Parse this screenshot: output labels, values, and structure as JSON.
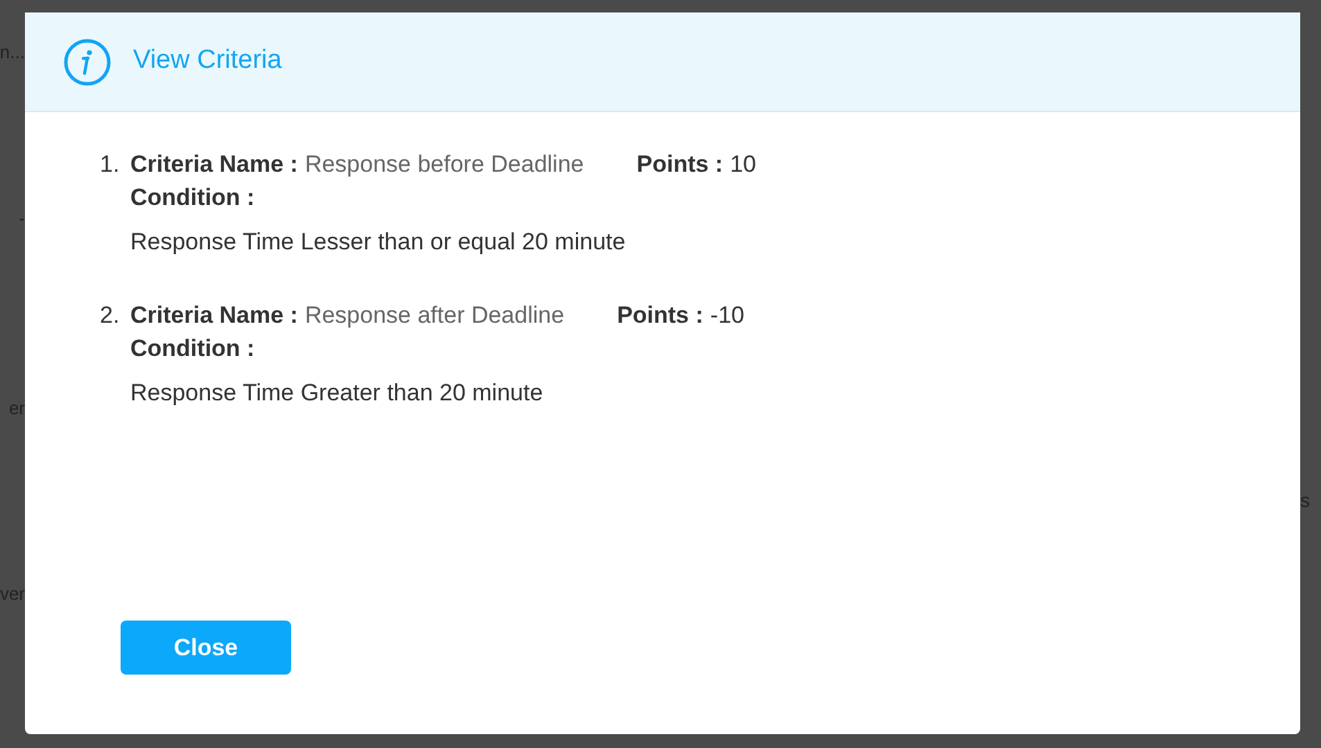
{
  "background": {
    "left_fragments": [
      "n...",
      "-",
      "er",
      "ver"
    ],
    "right_fragments": [
      "s"
    ]
  },
  "dialog": {
    "title": "View Criteria",
    "criteria": [
      {
        "number": "1.",
        "name_label": "Criteria Name :",
        "name": "Response before Deadline",
        "points_label": "Points :",
        "points": "10",
        "condition_label": "Condition :",
        "condition": "Response Time Lesser than or equal 20 minute"
      },
      {
        "number": "2.",
        "name_label": "Criteria Name :",
        "name": "Response after Deadline",
        "points_label": "Points :",
        "points": "-10",
        "condition_label": "Condition :",
        "condition": "Response Time Greater than 20 minute"
      }
    ],
    "buttons": [
      "Close"
    ]
  }
}
